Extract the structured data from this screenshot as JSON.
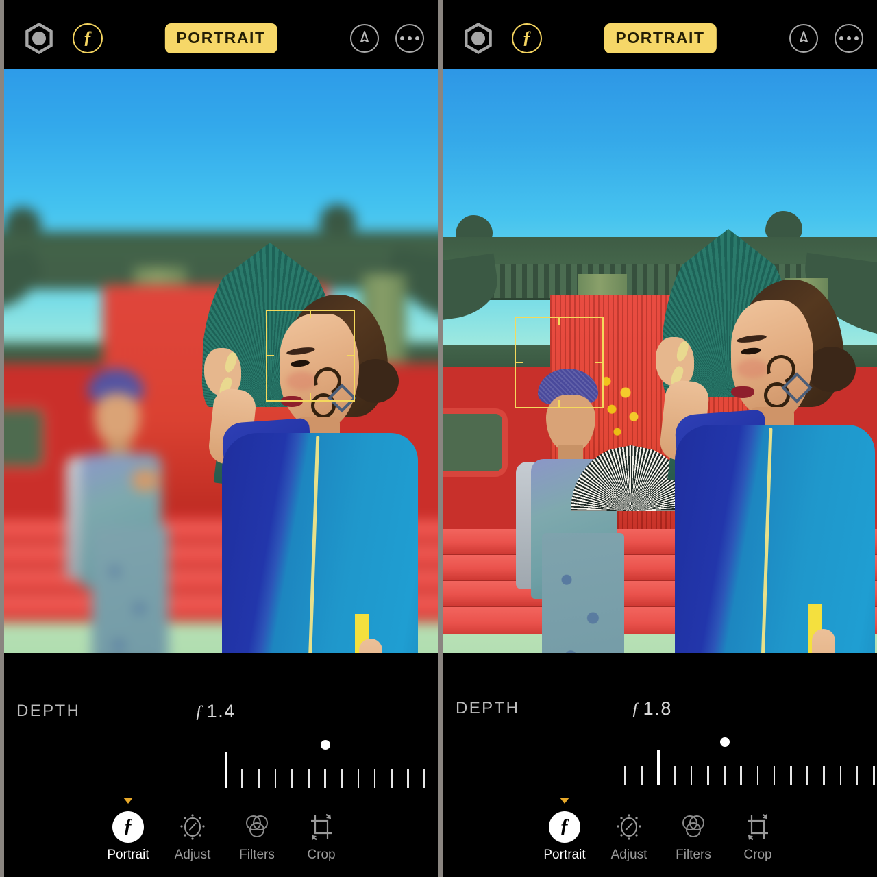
{
  "app": {
    "name": "photo-portrait-editor"
  },
  "panels": [
    {
      "id": "left",
      "topbar": {
        "lens_icon": "aperture-hexagon-icon",
        "depth_toggle_icon": "f-aperture-icon",
        "mode_badge": "PORTRAIT",
        "markup_icon": "markup-pen-icon",
        "more_icon": "more-options-icon"
      },
      "depth": {
        "label": "DEPTH",
        "value": "1.4",
        "value_prefix": "ƒ",
        "slider": {
          "major_tick_index": 0,
          "tick_count": 14,
          "knob_index": 6
        }
      },
      "toolbar": [
        {
          "label": "Portrait",
          "icon": "portrait-f-icon",
          "active": true
        },
        {
          "label": "Adjust",
          "icon": "adjust-dial-icon",
          "active": false
        },
        {
          "label": "Filters",
          "icon": "filters-circles-icon",
          "active": false
        },
        {
          "label": "Crop",
          "icon": "crop-rotate-icon",
          "active": false
        }
      ],
      "photo": {
        "focus_box": {
          "subject": "woman-face"
        },
        "blurred_background": true
      }
    },
    {
      "id": "right",
      "topbar": {
        "lens_icon": "aperture-hexagon-icon",
        "depth_toggle_icon": "f-aperture-icon",
        "mode_badge": "PORTRAIT",
        "markup_icon": "markup-pen-icon",
        "more_icon": "more-options-icon"
      },
      "depth": {
        "label": "DEPTH",
        "value": "1.8",
        "value_prefix": "ƒ",
        "slider": {
          "major_tick_index": 2,
          "tick_count": 16,
          "knob_index": 6
        }
      },
      "toolbar": [
        {
          "label": "Portrait",
          "icon": "portrait-f-icon",
          "active": true
        },
        {
          "label": "Adjust",
          "icon": "adjust-dial-icon",
          "active": false
        },
        {
          "label": "Filters",
          "icon": "filters-circles-icon",
          "active": false
        },
        {
          "label": "Crop",
          "icon": "crop-rotate-icon",
          "active": false
        }
      ],
      "photo": {
        "focus_box": {
          "subject": "man-face"
        },
        "blurred_background": false
      }
    }
  ],
  "colors": {
    "accent_yellow": "#f6d768",
    "focus_box": "#f4d95c",
    "caret_orange": "#e8a92a",
    "panel_background": "#000000",
    "page_background": "#8a8580",
    "label_gray": "#bdbdbd"
  }
}
